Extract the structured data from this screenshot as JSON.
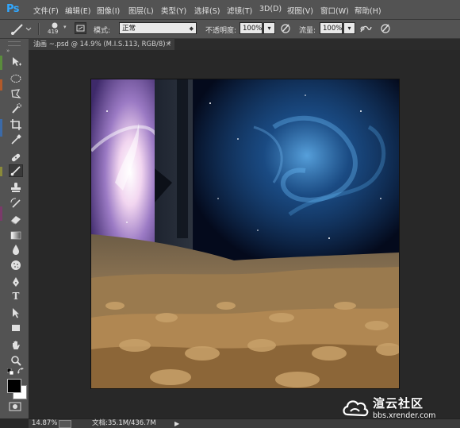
{
  "app": {
    "logo": "Ps"
  },
  "menu": [
    "文件(F)",
    "编辑(E)",
    "图像(I)",
    "图层(L)",
    "类型(Y)",
    "选择(S)",
    "滤镜(T)",
    "3D(D)",
    "视图(V)",
    "窗口(W)",
    "帮助(H)"
  ],
  "options": {
    "brush_size": "419",
    "mode_label": "模式:",
    "mode_value": "正常",
    "opacity_label": "不透明度:",
    "opacity_value": "100%",
    "flow_label": "流量:",
    "flow_value": "100%"
  },
  "document_tab": {
    "title": "油画 ~.psd @ 14.9% (M.I.S.113, RGB/8) *",
    "close": "×"
  },
  "tools": [
    "move-tool",
    "marquee-tool",
    "lasso-tool",
    "quick-selection-tool",
    "crop-tool",
    "eyedropper-tool",
    "healing-brush-tool",
    "brush-tool",
    "clone-stamp-tool",
    "history-brush-tool",
    "eraser-tool",
    "gradient-tool",
    "blur-tool",
    "dodge-tool",
    "pen-tool",
    "type-tool",
    "path-selection-tool",
    "rectangle-tool",
    "hand-tool",
    "zoom-tool"
  ],
  "type_tool_glyph": "T",
  "colors": {
    "foreground": "#000000",
    "background": "#ffffff",
    "panel": "#535353",
    "workspace": "#282828",
    "accent": "#31a8ff"
  },
  "status": {
    "zoom": "14.87%",
    "doc_size": "文档:35.1M/436.7M"
  },
  "watermark": {
    "title": "渲云社区",
    "url": "bbs.xrender.com"
  }
}
